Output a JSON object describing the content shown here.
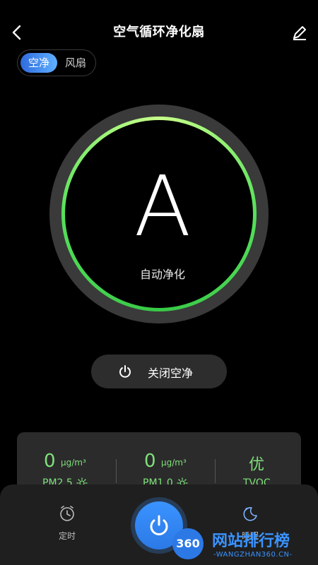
{
  "header": {
    "title": "空气循环净化扇",
    "back_icon": "chevron-left-icon",
    "edit_icon": "pencil-icon"
  },
  "mode_toggle": {
    "options": [
      "空净",
      "风扇"
    ],
    "selected": "空净"
  },
  "dial": {
    "mode_letter": "A",
    "mode_label": "自动净化",
    "ring_color": "#4fdc5a"
  },
  "power_button": {
    "label": "关闭空净",
    "icon": "power-icon"
  },
  "stats": [
    {
      "value": "0",
      "unit": "μg/m³",
      "label": "PM2.5",
      "icon": "sun-icon"
    },
    {
      "value": "0",
      "unit": "μg/m³",
      "label": "PM1.0",
      "icon": "sun-icon"
    },
    {
      "value": "优",
      "unit": "",
      "label": "TVOC"
    }
  ],
  "bottom_bar": {
    "timer_label": "定时",
    "timer_icon": "clock-icon",
    "main_power_icon": "power-icon",
    "sleep_icon": "moon-stars-icon",
    "sleep_label": "睡眠"
  },
  "watermark": {
    "badge": "360",
    "text": "网站排行榜",
    "sub": "-WANGZHAN360.CN-"
  },
  "colors": {
    "accent_green": "#7fe07b",
    "accent_blue": "#3a93ff",
    "background": "#000000"
  }
}
